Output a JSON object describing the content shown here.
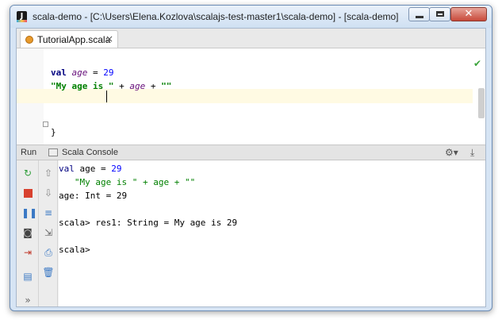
{
  "window": {
    "title": "scala-demo - [C:\\Users\\Elena.Kozlova\\scalajs-test-master1\\scala-demo] - [scala-demo]",
    "app_icon_letter": "J"
  },
  "editor": {
    "tab_label": "TutorialApp.scala",
    "lines": {
      "l1": {
        "kw": "val",
        "var": "age",
        "op": " = ",
        "num": "29"
      },
      "l2": {
        "str1": "\"My age is \"",
        "op1": " + ",
        "var": "age",
        "op2": " + ",
        "str2": "\"\""
      },
      "l4": "}"
    }
  },
  "run_panel": {
    "run_label": "Run",
    "console_name": "Scala Console"
  },
  "console": {
    "line1": {
      "kw": "val",
      "rest": " age = ",
      "num": "29"
    },
    "line2": "   \"My age is \" + age + \"\"",
    "line3": "age: Int = 29",
    "line4": "scala> res1: String = My age is 29",
    "line5": "scala>"
  },
  "colors": {
    "keyword": "#000080",
    "string": "#008000",
    "number": "#0000ff",
    "current_line": "#fffae3"
  }
}
